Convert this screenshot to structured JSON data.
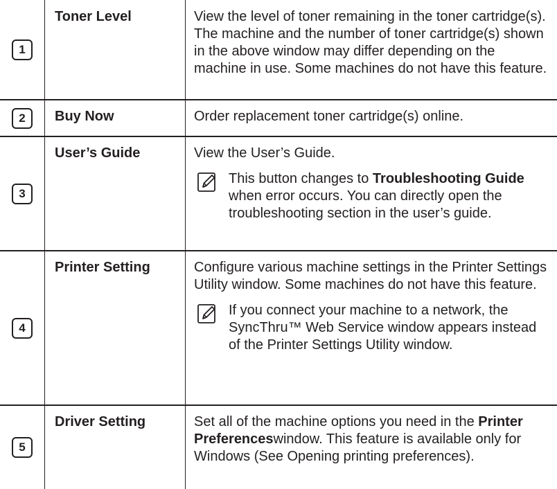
{
  "rows": [
    {
      "number": "1",
      "term": "Toner Level",
      "description": "View the level of toner remaining in the toner cartridge(s). The machine and the number of toner cartridge(s) shown in the above window may differ depending on the machine in use. Some machines do not have this feature."
    },
    {
      "number": "2",
      "term": "Buy Now",
      "description": "Order replacement toner cartridge(s) online."
    },
    {
      "number": "3",
      "term": "User’s Guide",
      "description": "View the User’s Guide.",
      "note": {
        "icon": "note-pencil-icon",
        "text_before": "This button changes to ",
        "bold": "Troubleshooting Guide",
        "text_after": " when error occurs. You can directly open the troubleshooting section in the user’s guide."
      }
    },
    {
      "number": "4",
      "term": "Printer Setting",
      "description": "Configure various machine settings in the Printer Settings Utility window. Some machines do not have this feature.",
      "note": {
        "icon": "note-pencil-icon",
        "text": "If you connect your machine to a network, the SyncThru™ Web Service window appears instead of the Printer Settings Utility window."
      }
    },
    {
      "number": "5",
      "term": "Driver Setting",
      "description_before": "Set all of the machine options you need in the ",
      "description_bold": "Printer Preferences",
      "description_after": "window. This feature is available only for Windows (See Opening printing preferences)."
    }
  ]
}
